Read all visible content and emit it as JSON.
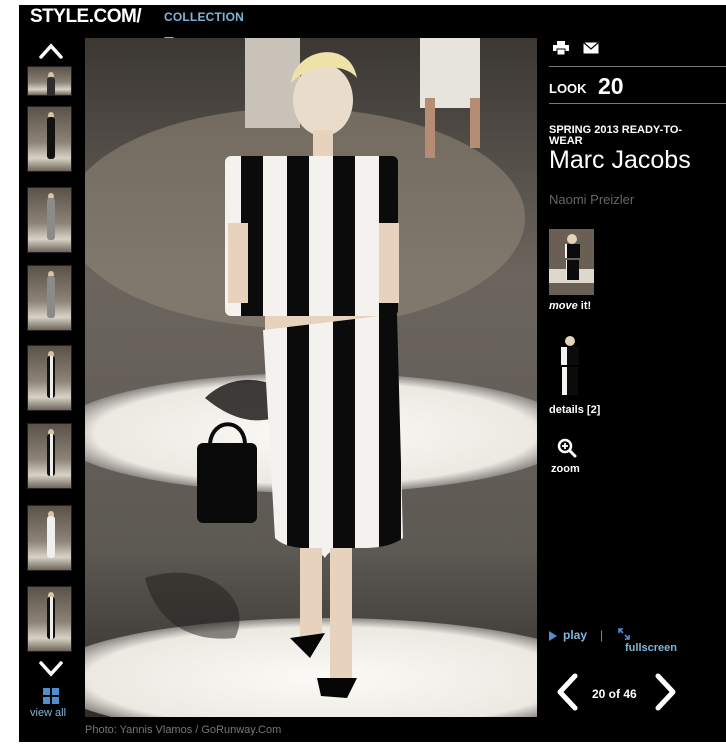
{
  "header": {
    "brand": "STYLE.COM/",
    "section": "COLLECTION"
  },
  "sidebar": {
    "view_all_label": "view all",
    "thumbnails": [
      {
        "outfit": "dark"
      },
      {
        "outfit": "black"
      },
      {
        "outfit": "grey"
      },
      {
        "outfit": "grey"
      },
      {
        "outfit": "stripe"
      },
      {
        "outfit": "stripe"
      },
      {
        "outfit": "white"
      },
      {
        "outfit": "stripe"
      }
    ]
  },
  "photo": {
    "credit": "Photo: Yannis Vlamos / GoRunway.Com"
  },
  "panel": {
    "look_label": "LOOK",
    "look_number": "20",
    "season": "SPRING 2013 READY-TO-WEAR",
    "designer": "Marc Jacobs",
    "model": "Naomi Preizler",
    "move_prefix": "move",
    "move_suffix": " it!",
    "details_label": "details [2]",
    "zoom_label": "zoom",
    "play_label": "play",
    "separator": "|",
    "fullscreen_label": "fullscreen",
    "pager": "20 of 46"
  },
  "colors": {
    "accent": "#7fb6d9",
    "background": "#000000"
  }
}
